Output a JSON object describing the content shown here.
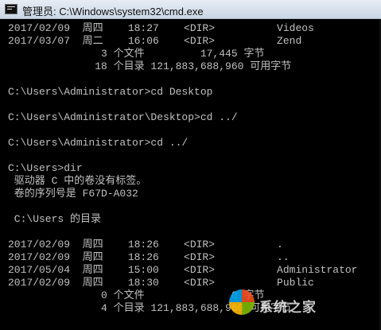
{
  "window": {
    "title": "管理员: C:\\Windows\\system32\\cmd.exe"
  },
  "console_lines": [
    "2017/02/09  周四    18:27    <DIR>          Videos",
    "2017/03/07  周二    16:06    <DIR>          Zend",
    "               3 个文件         17,445 字节",
    "              18 个目录 121,883,688,960 可用字节",
    "",
    "C:\\Users\\Administrator>cd Desktop",
    "",
    "C:\\Users\\Administrator\\Desktop>cd ../",
    "",
    "C:\\Users\\Administrator>cd ../",
    "",
    "C:\\Users>dir",
    " 驱动器 C 中的卷没有标签。",
    " 卷的序列号是 F67D-A032",
    "",
    " C:\\Users 的目录",
    "",
    "2017/02/09  周四    18:26    <DIR>          .",
    "2017/02/09  周四    18:26    <DIR>          ..",
    "2017/05/04  周四    15:00    <DIR>          Administrator",
    "2017/02/09  周四    18:30    <DIR>          Public",
    "               0 个文件              0 字节",
    "               4 个目录 121,883,688,960 可用字节"
  ],
  "watermark": {
    "text": "系统之家"
  }
}
